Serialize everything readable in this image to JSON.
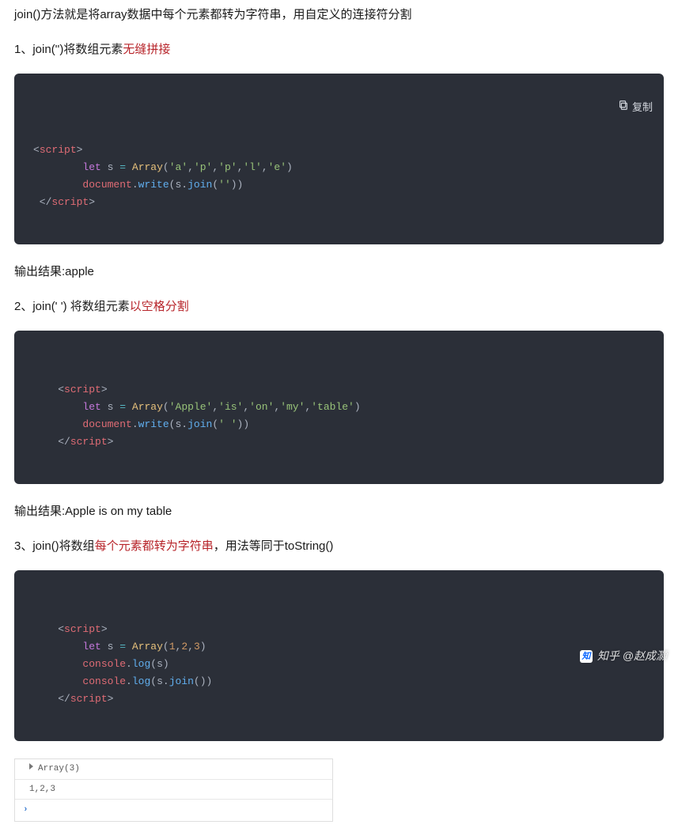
{
  "intro": "join()方法就是将array数据中每个元素都转为字符串，用自定义的连接符分割",
  "copy_label": "复制",
  "sections": [
    {
      "lead_plain": "1、join('')将数组元素",
      "lead_hl": "无缝拼接",
      "lead_tail": "",
      "has_copy": true,
      "code_tokens": [
        [
          [
            "punc",
            "<"
          ],
          [
            "tag",
            "script"
          ],
          [
            "punc",
            ">"
          ]
        ],
        [
          [
            "punc",
            "        "
          ],
          [
            "kw",
            "let"
          ],
          [
            "punc",
            " "
          ],
          [
            "var",
            "s"
          ],
          [
            "punc",
            " "
          ],
          [
            "op",
            "="
          ],
          [
            "punc",
            " "
          ],
          [
            "cls",
            "Array"
          ],
          [
            "punc",
            "("
          ],
          [
            "str",
            "'a'"
          ],
          [
            "punc",
            ","
          ],
          [
            "str",
            "'p'"
          ],
          [
            "punc",
            ","
          ],
          [
            "str",
            "'p'"
          ],
          [
            "punc",
            ","
          ],
          [
            "str",
            "'l'"
          ],
          [
            "punc",
            ","
          ],
          [
            "str",
            "'e'"
          ],
          [
            "punc",
            ")"
          ]
        ],
        [
          [
            "punc",
            "        "
          ],
          [
            "obj",
            "document"
          ],
          [
            "punc",
            "."
          ],
          [
            "fn",
            "write"
          ],
          [
            "punc",
            "("
          ],
          [
            "var",
            "s"
          ],
          [
            "punc",
            "."
          ],
          [
            "fn",
            "join"
          ],
          [
            "punc",
            "("
          ],
          [
            "str",
            "''"
          ],
          [
            "punc",
            "))"
          ]
        ],
        [
          [
            "punc",
            " </"
          ],
          [
            "tag",
            "script"
          ],
          [
            "punc",
            ">"
          ]
        ]
      ],
      "result": "输出结果:apple"
    },
    {
      "lead_plain": "2、join(' ') 将数组元素",
      "lead_hl": "以空格分割",
      "lead_tail": "",
      "has_copy": false,
      "code_tokens": [
        [
          [
            "punc",
            "    <"
          ],
          [
            "tag",
            "script"
          ],
          [
            "punc",
            ">"
          ]
        ],
        [
          [
            "punc",
            "        "
          ],
          [
            "kw",
            "let"
          ],
          [
            "punc",
            " "
          ],
          [
            "var",
            "s"
          ],
          [
            "punc",
            " "
          ],
          [
            "op",
            "="
          ],
          [
            "punc",
            " "
          ],
          [
            "cls",
            "Array"
          ],
          [
            "punc",
            "("
          ],
          [
            "str",
            "'Apple'"
          ],
          [
            "punc",
            ","
          ],
          [
            "str",
            "'is'"
          ],
          [
            "punc",
            ","
          ],
          [
            "str",
            "'on'"
          ],
          [
            "punc",
            ","
          ],
          [
            "str",
            "'my'"
          ],
          [
            "punc",
            ","
          ],
          [
            "str",
            "'table'"
          ],
          [
            "punc",
            ")"
          ]
        ],
        [
          [
            "punc",
            "        "
          ],
          [
            "obj",
            "document"
          ],
          [
            "punc",
            "."
          ],
          [
            "fn",
            "write"
          ],
          [
            "punc",
            "("
          ],
          [
            "var",
            "s"
          ],
          [
            "punc",
            "."
          ],
          [
            "fn",
            "join"
          ],
          [
            "punc",
            "("
          ],
          [
            "str",
            "' '"
          ],
          [
            "punc",
            "))"
          ]
        ],
        [
          [
            "punc",
            "    </"
          ],
          [
            "tag",
            "script"
          ],
          [
            "punc",
            ">"
          ]
        ]
      ],
      "result": "输出结果:Apple is on my table"
    },
    {
      "lead_plain": "3、join()将数组",
      "lead_hl": "每个元素都转为字符串",
      "lead_tail": "，用法等同于toString()",
      "has_copy": false,
      "code_tokens": [
        [
          [
            "punc",
            "    <"
          ],
          [
            "tag",
            "script"
          ],
          [
            "punc",
            ">"
          ]
        ],
        [
          [
            "punc",
            "        "
          ],
          [
            "kw",
            "let"
          ],
          [
            "punc",
            " "
          ],
          [
            "var",
            "s"
          ],
          [
            "punc",
            " "
          ],
          [
            "op",
            "="
          ],
          [
            "punc",
            " "
          ],
          [
            "cls",
            "Array"
          ],
          [
            "punc",
            "("
          ],
          [
            "num",
            "1"
          ],
          [
            "punc",
            ","
          ],
          [
            "num",
            "2"
          ],
          [
            "punc",
            ","
          ],
          [
            "num",
            "3"
          ],
          [
            "punc",
            ")"
          ]
        ],
        [
          [
            "punc",
            "        "
          ],
          [
            "obj",
            "console"
          ],
          [
            "punc",
            "."
          ],
          [
            "fn",
            "log"
          ],
          [
            "punc",
            "("
          ],
          [
            "var",
            "s"
          ],
          [
            "punc",
            ")"
          ]
        ],
        [
          [
            "punc",
            "        "
          ],
          [
            "obj",
            "console"
          ],
          [
            "punc",
            "."
          ],
          [
            "fn",
            "log"
          ],
          [
            "punc",
            "("
          ],
          [
            "var",
            "s"
          ],
          [
            "punc",
            "."
          ],
          [
            "fn",
            "join"
          ],
          [
            "punc",
            "())"
          ]
        ],
        [
          [
            "punc",
            "    </"
          ],
          [
            "tag",
            "script"
          ],
          [
            "punc",
            ">"
          ]
        ]
      ],
      "result": null
    }
  ],
  "console": {
    "row1": "Array(3)",
    "row2": "1,2,3"
  },
  "watermark": {
    "logo": "知",
    "text": "知乎 @赵成灝"
  }
}
